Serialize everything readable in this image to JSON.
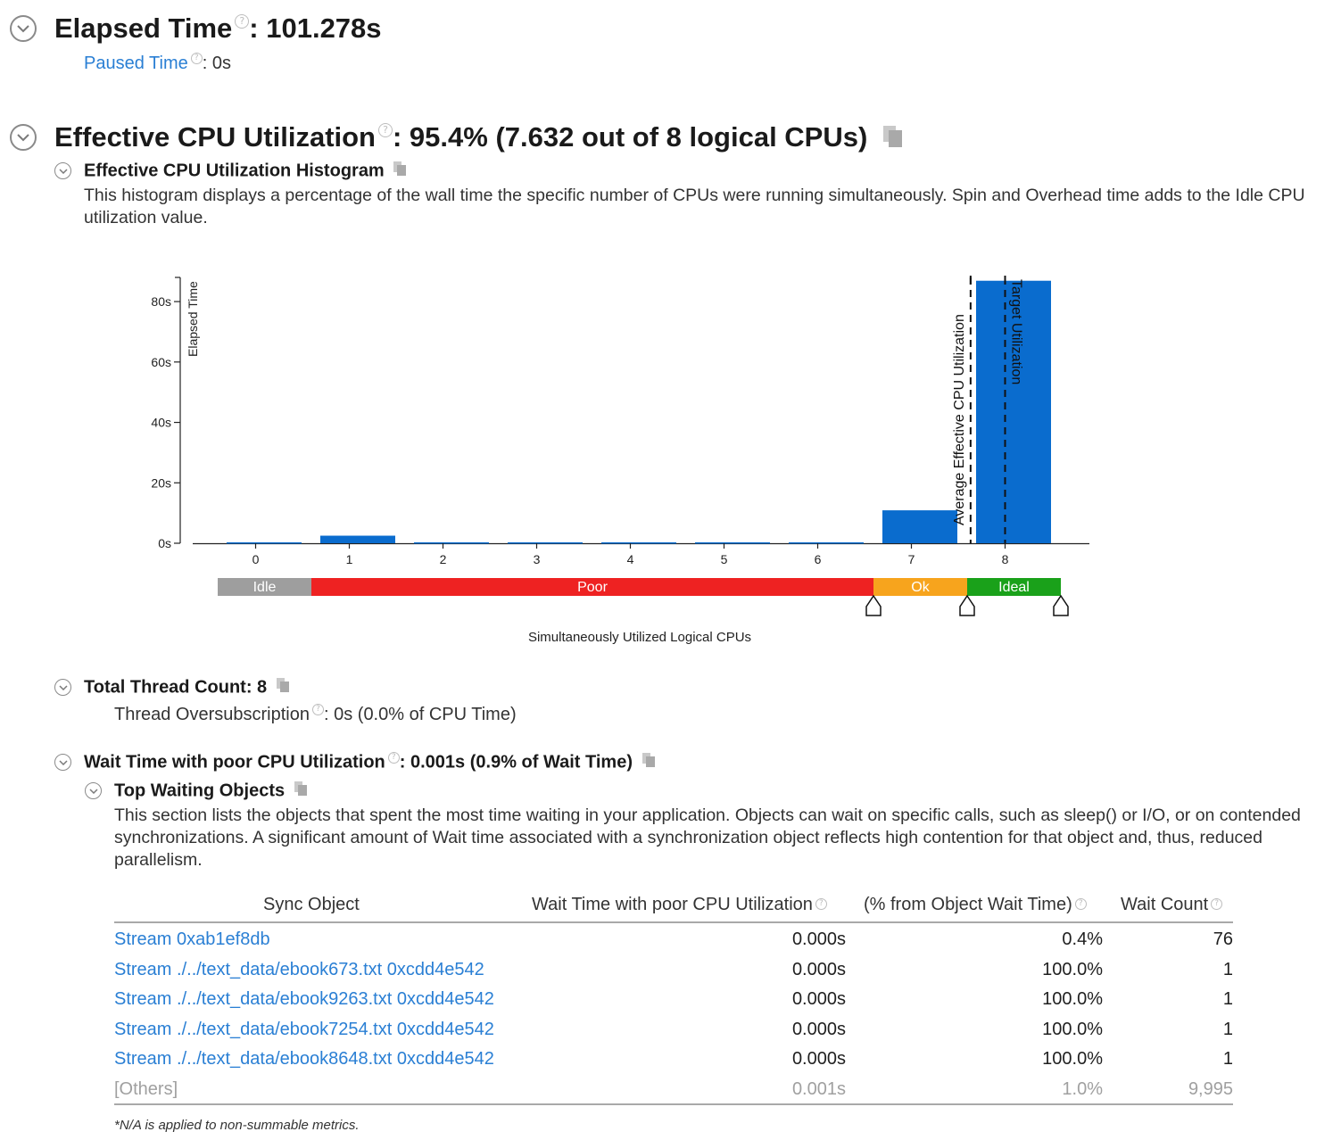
{
  "elapsed": {
    "label": "Elapsed Time",
    "value": ": 101.278s",
    "paused_label": "Paused Time",
    "paused_value": ": 0s"
  },
  "cpu": {
    "label": "Effective CPU Utilization",
    "value": ": 95.4% (7.632 out of 8 logical CPUs)",
    "histogram_title": "Effective CPU Utilization Histogram",
    "histogram_desc": "This histogram displays a percentage of the wall time the specific number of CPUs were running simultaneously. Spin and Overhead time adds to the Idle CPU utilization value."
  },
  "chart_data": {
    "type": "bar",
    "categories": [
      "0",
      "1",
      "2",
      "3",
      "4",
      "5",
      "6",
      "7",
      "8"
    ],
    "values": [
      0.3,
      2.5,
      0.3,
      0.3,
      0.3,
      0.3,
      0.3,
      10.9,
      86.9
    ],
    "ylabel": "Elapsed Time",
    "xlabel": "Simultaneously Utilized Logical CPUs",
    "yticks": [
      "0s",
      "20s",
      "40s",
      "60s",
      "80s"
    ],
    "ylim": [
      0,
      88
    ],
    "bar_color": "#0a6cce",
    "markers": [
      {
        "label": "Average Effective CPU Utilization",
        "x": 7.632
      },
      {
        "label": "Target Utilization",
        "x": 8
      }
    ],
    "zones": [
      {
        "label": "Idle",
        "color": "#9e9e9e"
      },
      {
        "label": "Poor",
        "color": "#ee2222"
      },
      {
        "label": "Ok",
        "color": "#f7a41d"
      },
      {
        "label": "Ideal",
        "color": "#1aa11a"
      }
    ]
  },
  "threads": {
    "title": "Total Thread Count: 8",
    "oversub_label": "Thread Oversubscription",
    "oversub_value": ": 0s (0.0% of CPU Time)"
  },
  "wait": {
    "label": "Wait Time with poor CPU Utilization",
    "value": ": 0.001s (0.9% of Wait Time)",
    "top_title": "Top Waiting Objects",
    "top_desc": "This section lists the objects that spent the most time waiting in your application. Objects can wait on specific calls, such as sleep() or I/O, or on contended synchronizations. A significant amount of Wait time associated with a synchronization object reflects high contention for that object and, thus, reduced parallelism."
  },
  "table": {
    "headers": [
      "Sync Object",
      "Wait Time with poor CPU Utilization",
      "(% from Object Wait Time)",
      "Wait Count"
    ],
    "rows": [
      [
        "Stream 0xab1ef8db",
        "0.000s",
        "0.4%",
        "76"
      ],
      [
        "Stream ./../text_data/ebook673.txt 0xcdd4e542",
        "0.000s",
        "100.0%",
        "1"
      ],
      [
        "Stream ./../text_data/ebook9263.txt 0xcdd4e542",
        "0.000s",
        "100.0%",
        "1"
      ],
      [
        "Stream ./../text_data/ebook7254.txt 0xcdd4e542",
        "0.000s",
        "100.0%",
        "1"
      ],
      [
        "Stream ./../text_data/ebook8648.txt 0xcdd4e542",
        "0.000s",
        "100.0%",
        "1"
      ],
      [
        "[Others]",
        "0.001s",
        "1.0%",
        "9,995"
      ]
    ],
    "footnote": "*N/A is applied to non-summable metrics."
  },
  "icons": {
    "collapse": "chevron-down-circle-icon",
    "help": "question-icon",
    "copy": "copy-icon"
  }
}
